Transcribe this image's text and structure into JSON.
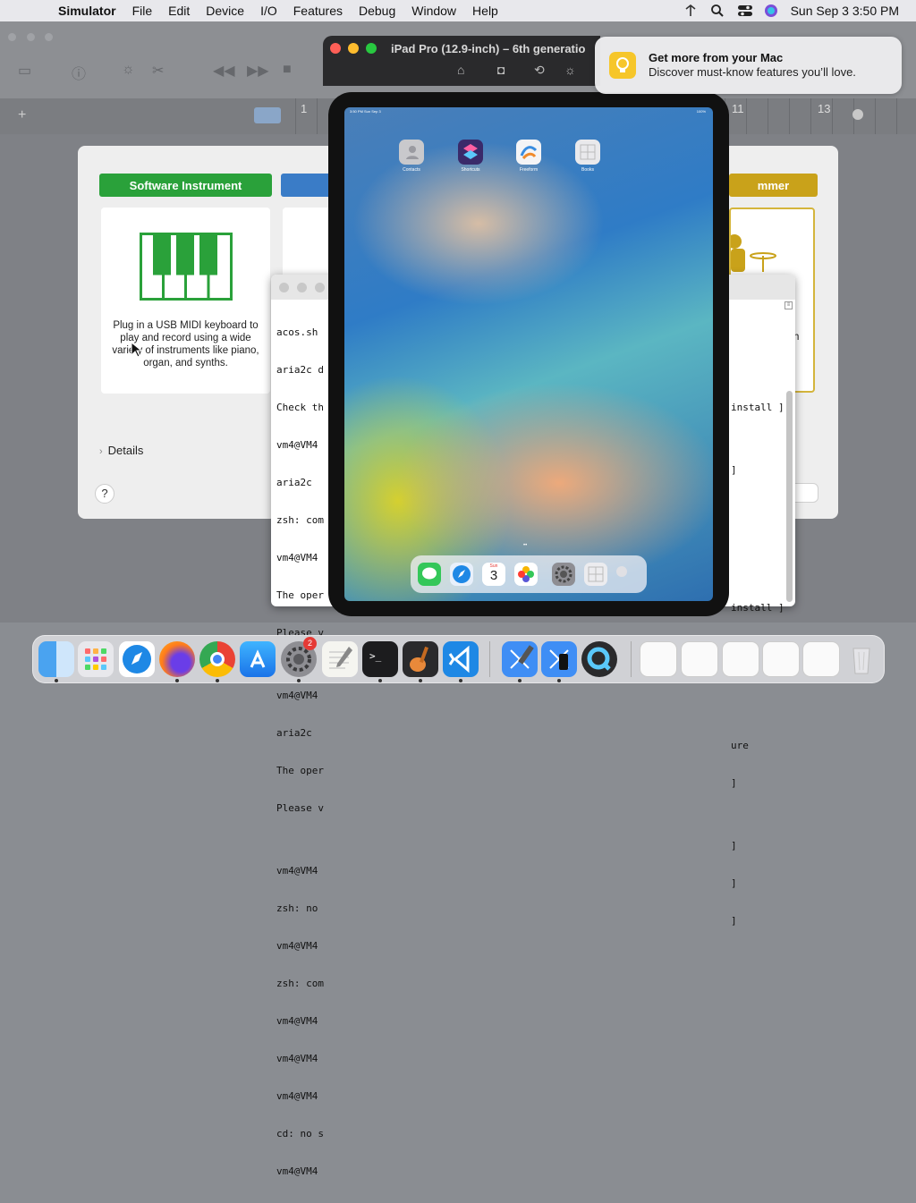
{
  "menubar": {
    "app_name": "Simulator",
    "items": [
      "File",
      "Edit",
      "Device",
      "I/O",
      "Features",
      "Debug",
      "Window",
      "Help"
    ],
    "datetime": "Sun Sep 3  3:50 PM"
  },
  "garageband": {
    "ruler_labels": [
      "1",
      "11",
      "13"
    ],
    "cards": [
      {
        "title": "Software Instrument",
        "color": "#2aa13a",
        "description": "Plug in a USB MIDI keyboard to play and record using a wide variety of instruments like piano, organ, and synths."
      },
      {
        "title": "",
        "color": "#3a7cc7",
        "description": ""
      },
      {
        "title": "mmer",
        "color": "#c9a21a",
        "description": "h"
      }
    ],
    "details_label": "Details",
    "help_label": "?",
    "choose_label": "te"
  },
  "terminal": {
    "lines": [
      "acos.sh",
      "aria2c d",
      "Check th",
      "vm4@VM4",
      "aria2c",
      "zsh: com",
      "vm4@VM4",
      "The oper",
      "Please v",
      "",
      "vm4@VM4",
      "aria2c",
      "The oper",
      "Please v",
      "",
      "vm4@VM4",
      "zsh: no",
      "vm4@VM4",
      "zsh: com",
      "vm4@VM4",
      "vm4@VM4",
      "vm4@VM4",
      "cd: no s",
      "vm4@VM4"
    ],
    "right_lines": [
      "",
      "",
      "",
      "install ]",
      "",
      "]",
      "",
      "",
      "",
      "",
      "install ]",
      "",
      "",
      "",
      "",
      "ure",
      "]",
      "",
      "]",
      "]",
      "]",
      "",
      "",
      ""
    ]
  },
  "simulator": {
    "title": "iPad Pro (12.9-inch) – 6th generatio",
    "status_time": "3:50 PM  Sun Sep 3",
    "status_battery": "100%",
    "apps": [
      {
        "name": "Contacts",
        "color": "#c9c9cc"
      },
      {
        "name": "Shortcuts",
        "color": "#d4358b"
      },
      {
        "name": "Freeform",
        "color": "#f4f4f6"
      },
      {
        "name": "Books",
        "color": "#e9e9ec"
      }
    ],
    "dock_date_day": "Sun",
    "dock_date_num": "3"
  },
  "notification": {
    "title": "Get more from your Mac",
    "body": "Discover must-know features you’ll love."
  },
  "dock": {
    "settings_badge": "2",
    "apps": [
      "finder",
      "launchpad",
      "safari",
      "firefox",
      "chrome",
      "app-store",
      "system-settings",
      "textedit",
      "terminal",
      "garageband",
      "vscode",
      "xcode",
      "simulator",
      "quicktime"
    ]
  }
}
